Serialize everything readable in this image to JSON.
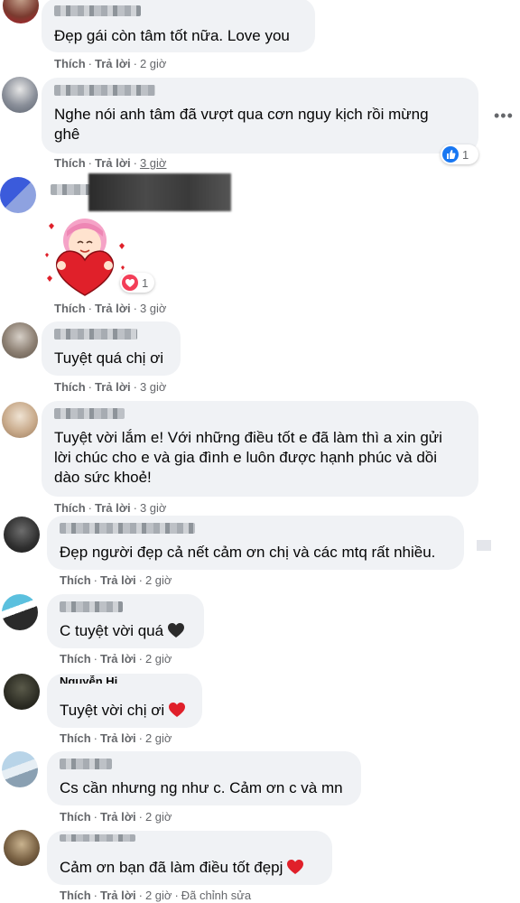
{
  "labels": {
    "like": "Thích",
    "reply": "Trả lời",
    "edited": "Đã chỉnh sửa"
  },
  "comments": [
    {
      "text": "Đẹp gái còn tâm tốt nữa. Love you",
      "time": "2 giờ"
    },
    {
      "text_lines": [
        "Nghe nói anh tâm đã vượt qua cơn nguy kịch rồi mừng",
        "ghê"
      ],
      "time": "3 giờ",
      "reaction": {
        "type": "like",
        "count": "1"
      }
    },
    {
      "sticker": "heart-girl-sticker",
      "time": "3 giờ",
      "reaction": {
        "type": "love",
        "count": "1"
      }
    },
    {
      "text": "Tuyệt quá chị ơi",
      "time": "3 giờ"
    },
    {
      "text_lines": [
        "Tuyệt vời lắm e! Với những điều tốt e đã làm thì a xin gửi",
        "lời chúc cho e và gia đình e luôn được hạnh phúc và dồi",
        "dào sức khoẻ!"
      ],
      "time": "3 giờ"
    },
    {
      "text": "Đẹp người đẹp cả nết cảm ơn chị và các mtq rất nhiều.",
      "time": "2 giờ"
    },
    {
      "text": "C tuyệt vời quá",
      "emoji": "black-heart",
      "time": "2 giờ"
    },
    {
      "name_partial": "Nguyễn Hi",
      "text": "Tuyệt vời chị ơi",
      "emoji": "red-heart",
      "time": "2 giờ"
    },
    {
      "text": "Cs cần nhưng ng như c. Cảm ơn c và mn",
      "time": "2 giờ"
    },
    {
      "text": "Cảm ơn bạn đã làm điều tốt đẹpj",
      "emoji": "red-heart",
      "time": "2 giờ",
      "edited": true
    }
  ],
  "colors": {
    "bubble": "#f0f2f5",
    "meta": "#65676b",
    "like_blue": "#1877f2",
    "love_red": "#f33e58"
  }
}
